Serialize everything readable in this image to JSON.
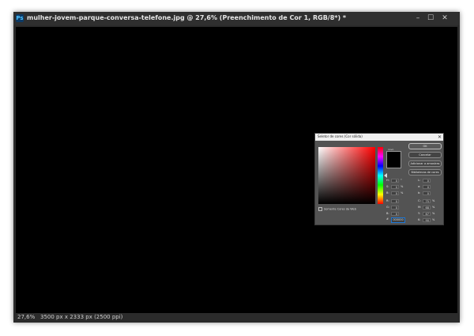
{
  "window": {
    "title": "mulher-jovem-parque-conversa-telefone.jpg @ 27,6% (Preenchimento de Cor 1, RGB/8*) *",
    "controls": {
      "minimize": "–",
      "maximize": "☐",
      "close": "✕"
    }
  },
  "status": {
    "zoom": "27,6%",
    "doc_info": "3500 px x 2333 px (2500 ppi)"
  },
  "dialog": {
    "title": "Seletor de cores (Cor sólida)",
    "close": "✕",
    "new_label": "novo",
    "swatch_color": "#000000",
    "buttons": {
      "ok": "OK",
      "cancel": "Cancelar",
      "add_swatch": "Adicionar a amostras",
      "libraries": "Bibliotecas de cores"
    },
    "only_web": "Somente Cores da Web",
    "left_fields": [
      {
        "label": "H:",
        "value": "0",
        "unit": "°"
      },
      {
        "label": "S:",
        "value": "0",
        "unit": "%"
      },
      {
        "label": "B:",
        "value": "0",
        "unit": "%"
      },
      {
        "label": "R:",
        "value": "0",
        "unit": ""
      },
      {
        "label": "G:",
        "value": "0",
        "unit": ""
      },
      {
        "label": "B:",
        "value": "0",
        "unit": ""
      }
    ],
    "right_fields": [
      {
        "label": "L:",
        "value": "0",
        "unit": ""
      },
      {
        "label": "a:",
        "value": "0",
        "unit": ""
      },
      {
        "label": "b:",
        "value": "0",
        "unit": ""
      },
      {
        "label": "C:",
        "value": "75",
        "unit": "%"
      },
      {
        "label": "M:",
        "value": "68",
        "unit": "%"
      },
      {
        "label": "Y:",
        "value": "67",
        "unit": "%"
      },
      {
        "label": "K:",
        "value": "90",
        "unit": "%"
      }
    ],
    "hex_label": "#",
    "hex_value": "000000"
  }
}
